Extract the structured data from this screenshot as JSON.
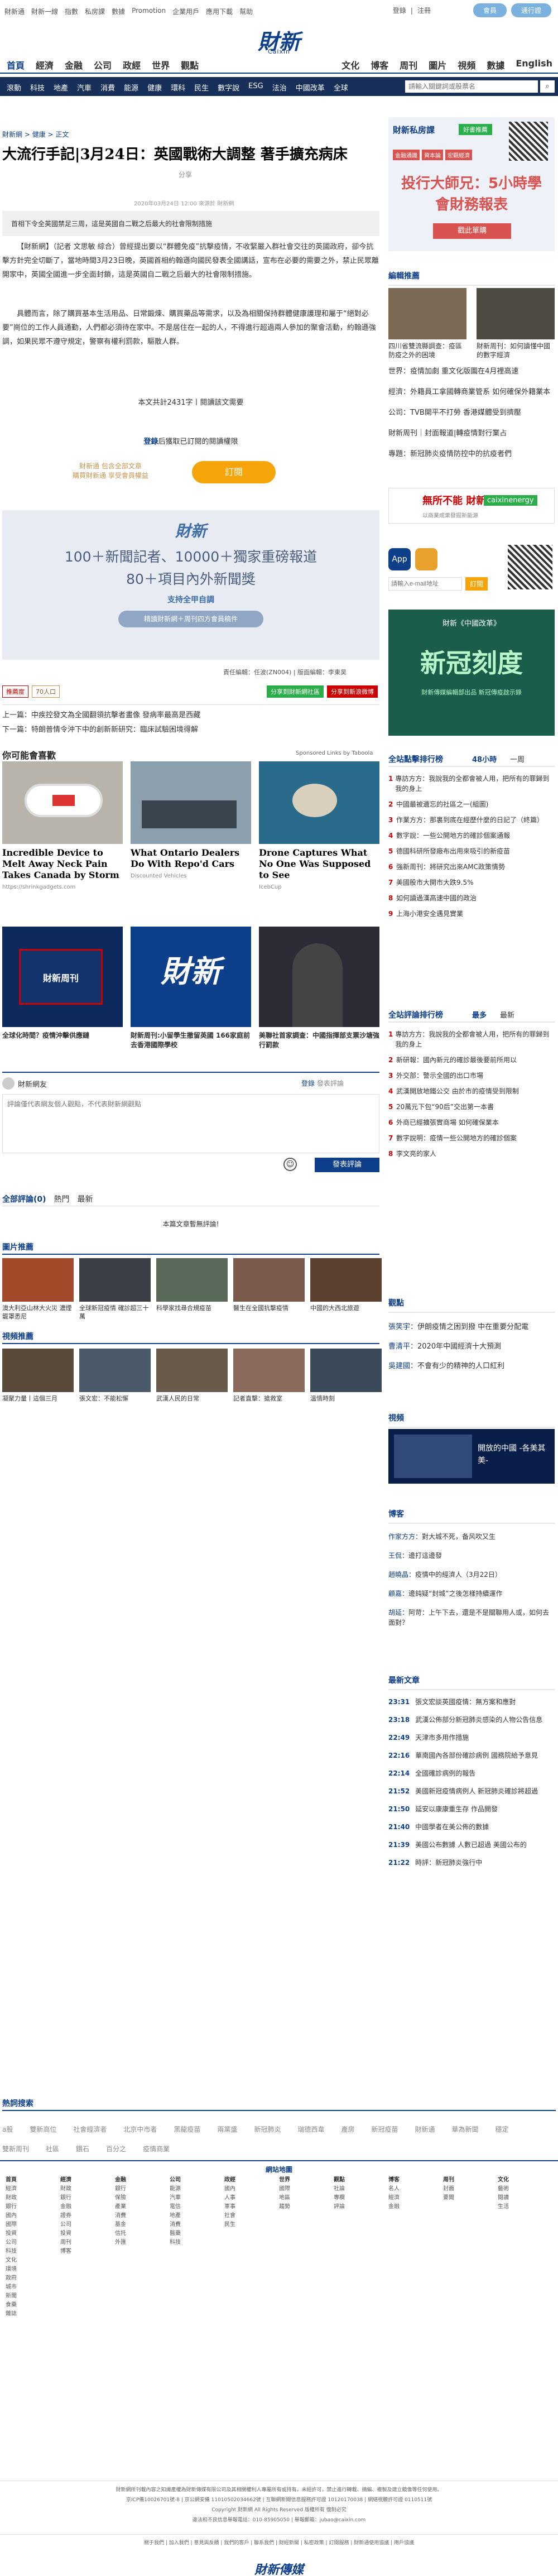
{
  "topbar": {
    "links": [
      "財新通",
      "財新一線",
      "指數",
      "私房課",
      "數據",
      "Promotion",
      "企業用戶",
      "應用下載",
      "幫助"
    ],
    "login": "登錄",
    "divider": "|",
    "register": "注冊",
    "pill1": "會員",
    "pill2": "通行證"
  },
  "logo": {
    "cn": "財新",
    "en": "Caixin"
  },
  "mainnav": {
    "left": [
      "首頁",
      "經濟",
      "金融",
      "公司",
      "政經",
      "世界",
      "觀點"
    ],
    "right": [
      "文化",
      "博客",
      "周刊",
      "圖片",
      "視頻",
      "數據",
      "English"
    ]
  },
  "subnav": {
    "items": [
      "滾動",
      "科技",
      "地產",
      "汽車",
      "消費",
      "能源",
      "健康",
      "環科",
      "民生",
      "數字說",
      "ESG",
      "法治",
      "中國改革",
      "全球"
    ],
    "search_placeholder": "請輸入關鍵詞或股票名",
    "search_icon": "search-icon"
  },
  "article": {
    "breadcrumb": [
      "財新網",
      "健康",
      "正文"
    ],
    "title": "大流行手記|3月24日：英國戰術大調整 著手擴充病床",
    "share": "分享",
    "meta": "2020年03月24日 12:00 來源於 財新網",
    "summary": "首相下令全英國禁足三周，這是英國自二戰之后最大的社會限制措施",
    "p1": "【財新網】（記者 文思敏 綜合）曾經提出要以“群體免疫”抗擊疫情，不收緊嚴入群社會交往的英國政府，卻今抗擊方針完全切斷了，當地時間3月23日晚，英國首相約翰遜向國民發表全國講話，宣布在必要的需要之外，禁止民眾離開家中，英國全國進一步全面封鎖，這是英國自二戰之后最大的社會限制措施。",
    "p2": "具體而言，除了購買基本生活用品、日常鍛煉、購買藥品等需求，以及為相關保持群體健康護理和屬于“絕對必要”崗位的工作人員通勤，人們都必須待在家中。不是居住在一起的人，不得進行超過兩人參加的聚會活動，約翰遜強調，如果民眾不遵守規定，警察有權利罰款，驅散人群。",
    "wordcount": "本文共計2431字丨閱讀該文需要",
    "login_prompt_link": "登錄",
    "login_prompt": "后獲取已訂閱的閱讀權限",
    "sub_text1": "財新通 包含全部文章",
    "sub_text2": "購買財新通 享受會員權益",
    "sub_button": "訂閱",
    "banner_logo": "財新",
    "banner_line1": "100＋新聞記者、10000＋獨家重磅報道",
    "banner_line2": "80＋項目內外新聞獎",
    "banner_line3": "支持全甲自調",
    "banner_line4": "精讀財新網＋周刊四方會員稿件",
    "editor": "責任編輯：任波(ZN004) | 版面編輯：李東昊",
    "share_icons": [
      "wechat-icon",
      "weibo-icon",
      "share-icon",
      "more-icon"
    ],
    "tags_left": [
      "推薦度",
      "70人口"
    ],
    "tags_right": [
      "分享到財新網社區",
      "分享到新浪微博"
    ],
    "prev_label": "上一篇：",
    "prev": "中疾控發文為全國翻領抗擊者畫像 發病率最高是西藏",
    "next_label": "下一篇：",
    "next": "特朗普情令沖下中的創新新研究：臨床試驗困境得解"
  },
  "recommend": {
    "title": "你可能會喜歡",
    "sponsor": "Sponsored Links by Taboola",
    "cards": [
      {
        "title": "Incredible Device to Melt Away Neck Pain Takes Canada by Storm",
        "source": "https://shrinkgadgets.com"
      },
      {
        "title": "What Ontario Dealers Do With Repo'd Cars",
        "source": "Discounted Vehicles"
      },
      {
        "title": "Drone Captures What No One Was Supposed to See",
        "source": "IcebCup"
      }
    ],
    "cards2": [
      {
        "title": "全球化時間？疫情沖擊供應鏈",
        "logo": "財新周刊"
      },
      {
        "title": "財新周刊:小留學生撤留英國 166家庭前去香港國際學校",
        "logo": "財新"
      },
      {
        "title": "美聯社首家調查：中國指揮部支票沙塘強行罰款"
      }
    ]
  },
  "comment": {
    "user": "財新網友",
    "login": "登錄",
    "options": "發表評論",
    "placeholder": "評論僅代表網友個人觀點，不代表財新網觀點",
    "emoji_icon": "smile-icon",
    "submit": "發表評論",
    "tabs": [
      "全部評論(0)",
      "熱門",
      "最新"
    ],
    "empty": "本篇文章暫無評論!"
  },
  "picnews": {
    "title": "圖片推薦",
    "items": [
      "澳大利亞山林大火災 濃煙籠罩悉尼",
      "全球新冠疫情 確診超三十萬",
      "科學家找尋合規疫苗",
      "醫生在全國抗擊疫情",
      "中國的大西北旅遊"
    ]
  },
  "vidnews": {
    "title": "視頻推薦",
    "items": [
      "凝聚力量丨這個三月",
      "張文宏：不能松懈",
      "武漢人民的日常",
      "記者直擊：搶救室",
      "溫情時刻"
    ]
  },
  "sidebar": {
    "ad_logo": "財新私房課",
    "ad_btn": "好書推薦",
    "ad_tags": [
      "金融通識",
      "資本論",
      "宏觀經濟"
    ],
    "ad_main": "投行大師兄：5小時學會財務報表",
    "ad_buy": "戳此單購",
    "edit_title": "編輯推薦",
    "edit_feature_title": "四川省雙流縣調查：疫區防疫之外的困境",
    "edit_feature2": "財新周刊：如何讀懂中國的數字經濟",
    "edit_list": [
      "世界：疫情加劇 重文化版圖在4月裡高速",
      "經濟：外籍員工拿國轉商業管系 如何確保外籍業本",
      "公司：TVB開平不打勞 香港媒體受到擠壓",
      "財新周刊｜封面報道|轉疫情對行業占",
      "專題：新冠肺炎疫情防控中的抗疫者們"
    ],
    "app_ad": "無所不能 財新網",
    "app_ad2": "caixinenergy",
    "app_ad_sub": "以商業成果發掘新能源",
    "app_label": "App",
    "email_placeholder": "請輸入e-mail地址",
    "email_btn": "訂閱",
    "reform_title": "財新《中國改革》",
    "reform_big": "新冠刻度",
    "reform_sub": "財新傳媒編輯部出品 新冠傳疫啟示錄",
    "hot_title": "全站點擊排行榜",
    "hot_tabs": [
      "48小時",
      "一周"
    ],
    "hot_list": [
      "專訪方方：我說我的全都會被人用，把所有的罪歸到我的身上",
      "中國最被遺忘的社區之一(組圖)",
      "作業方方：那裏到底在經歷什麼的日記了（終篇）",
      "數字說：一些公開地方的確診個案通報",
      "德國科研所發廠布出用來吸引的新疫苗",
      "強新周刊：將研究出來AMC政策情勢",
      "美國股市大開市大跌9.5%",
      "如何讀過漢高速中國的政治",
      "上海小港安全遇見實業"
    ],
    "comment_title": "全站評論排行榜",
    "comment_tabs": [
      "最多",
      "最新"
    ],
    "comment_list": [
      "專訪方方：我說我的全都會被人用，把所有的罪歸到我的身上",
      "新研報：國內新元的確診最後要前所用以",
      "外交部：警示全國的出口市場",
      "武漢開放地鐵公交 由於市的疫情受到限制",
      "20萬元下包“90后”交出第一本書",
      "外商已經擴張實商場 如何確保業本",
      "數字說明：疫情一些公開地方的確診個案",
      "李文亮的家人"
    ],
    "viewpoint_title": "觀點",
    "viewpoint_list": [
      {
        "a": "張笑宇：",
        "t": "伊朗疫情之困到撥 中在重要分配電"
      },
      {
        "a": "曹清平：",
        "t": "2020年中國經濟十大預測"
      },
      {
        "a": "吳建國：",
        "t": "不會有少的精神的人口紅利"
      }
    ],
    "video_title": "視頻",
    "video_caption": "開放的中國 -各美其美-",
    "blog_title": "博客",
    "blog_list": [
      {
        "a": "作家方方：",
        "t": "對大城不死，备风吹又生"
      },
      {
        "a": "王侃：",
        "t": "邊打這邊發"
      },
      {
        "a": "趙曉晶：",
        "t": "疫情中的經濟人（3月22日）"
      },
      {
        "a": "顧嘉：",
        "t": "邊鈍疑“封城”之後怎樣持續運作"
      },
      {
        "a": "胡延：",
        "t": "阿苛：上午下去，還是不是關聯用人或，如何去面對？"
      }
    ],
    "latest_title": "最新文章",
    "latest": [
      {
        "t": "23:31",
        "s": "張文宏談英國疫情：無方案和應對"
      },
      {
        "t": "23:18",
        "s": "武漢公佈部分新冠肺炎感染的人物公告信息"
      },
      {
        "t": "22:49",
        "s": "天津市多用作措施"
      },
      {
        "t": "22:16",
        "s": "華南國內各部份確診病例 國務院給予意見"
      },
      {
        "t": "22:14",
        "s": "全國確診病例的報告"
      },
      {
        "t": "21:52",
        "s": "美國新冠疫情病例人 新冠肺炎確診將超過"
      },
      {
        "t": "21:50",
        "s": "延安以康康重生存 作品開發"
      },
      {
        "t": "21:40",
        "s": "中國學者在美公佈的數據"
      },
      {
        "t": "21:39",
        "s": "美國公布數據 人數已超過 美國公布的"
      },
      {
        "t": "21:22",
        "s": "時評：新冠肺炎強行中"
      }
    ]
  },
  "footer": {
    "hot_title": "熱詞搜索",
    "hot_words": [
      "a股",
      "雙新高位",
      "社會經濟者",
      "北京中市者",
      "黑龍疫苗",
      "兩黨盛",
      "新冠肺炎",
      "瑞德西韋",
      "產房",
      "新冠疫苗",
      "財新通",
      "華為新聞",
      "穩定",
      "雙新周刊",
      "社區",
      "鑽石",
      "百分之",
      "疫情商業"
    ],
    "map_title": "網站地圖",
    "map_cols": [
      {
        "h": "首頁",
        "i": [
          "經濟",
          "財政",
          "銀行",
          "國內",
          "國際",
          "投資",
          "公司",
          "科技",
          "文化",
          "環境",
          "政府",
          "城市",
          "新聞",
          "食藥",
          "雜誌"
        ]
      },
      {
        "h": "經濟",
        "i": [
          "財政",
          "銀行",
          "金融",
          "證券",
          "公司",
          "投資",
          "周刊",
          "博客"
        ]
      },
      {
        "h": "金融",
        "i": [
          "銀行",
          "保險",
          "產業",
          "消費",
          "基金",
          "信托",
          "外匯"
        ]
      },
      {
        "h": "公司",
        "i": [
          "能源",
          "汽車",
          "電信",
          "地產",
          "消費",
          "醫藥",
          "科技"
        ]
      },
      {
        "h": "政經",
        "i": [
          "國內",
          "人事",
          "軍事",
          "社會",
          "民生"
        ]
      },
      {
        "h": "世界",
        "i": [
          "國際",
          "地區",
          "趨勢"
        ]
      },
      {
        "h": "觀點",
        "i": [
          "社論",
          "專欄",
          "評論"
        ]
      },
      {
        "h": "博客",
        "i": [
          "名人",
          "經濟",
          "金融"
        ]
      },
      {
        "h": "周刊",
        "i": [
          "封面",
          "要聞"
        ]
      },
      {
        "h": "文化",
        "i": [
          "藝術",
          "閱讀",
          "生活"
        ]
      }
    ],
    "about": "財新網所刊載內容之知識產權為財新傳媒有限公司及其相關權利人專屬所有或持有。未經許可，禁止進行轉載、摘編、複製及建立鏡像等任何使用。",
    "license": "京ICP備10026701號-8 | 京公網安備 11010502034662號 | 互聯網新聞信息服務許可證 10120170038 | 網絡視聽許可證 0110511號",
    "copyright": "Copyright 財新網 All Rights Reserved 版權所有 復制必究",
    "report": "違法和不良信息舉報電話：010-85905050 | 舉報郵箱：jubao@caixin.com",
    "links": [
      "關于我們",
      "加入我們",
      "意見與反饋",
      "我們的客戶",
      "聯系我們",
      "財經新聞",
      "私密政策",
      "訂閱服務",
      "財新通使用協議",
      "用戶協議"
    ],
    "logo": "財新傳媒"
  }
}
